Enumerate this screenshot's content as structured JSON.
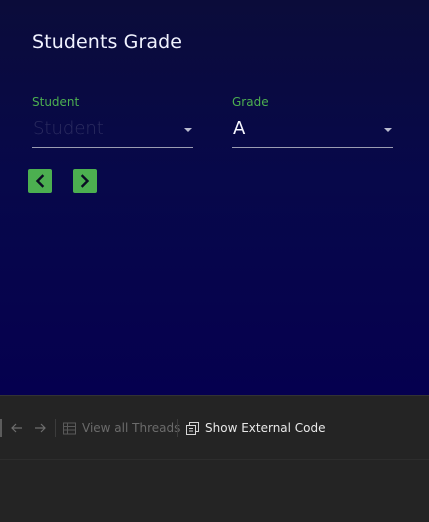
{
  "app": {
    "title": "Students Grade",
    "student_field": {
      "label": "Student",
      "placeholder": "Student",
      "value": ""
    },
    "grade_field": {
      "label": "Grade",
      "value": "A"
    },
    "nav": {
      "prev_icon": "chevron-left-icon",
      "next_icon": "chevron-right-icon"
    },
    "colors": {
      "accent": "#4caf50",
      "background_top": "#0b0c3a",
      "background_bottom": "#05004f"
    }
  },
  "ide_toolbar": {
    "back_icon": "arrow-left-icon",
    "forward_icon": "arrow-right-icon",
    "view_threads_label": "View all Threads",
    "show_external_code_label": "Show External Code"
  }
}
